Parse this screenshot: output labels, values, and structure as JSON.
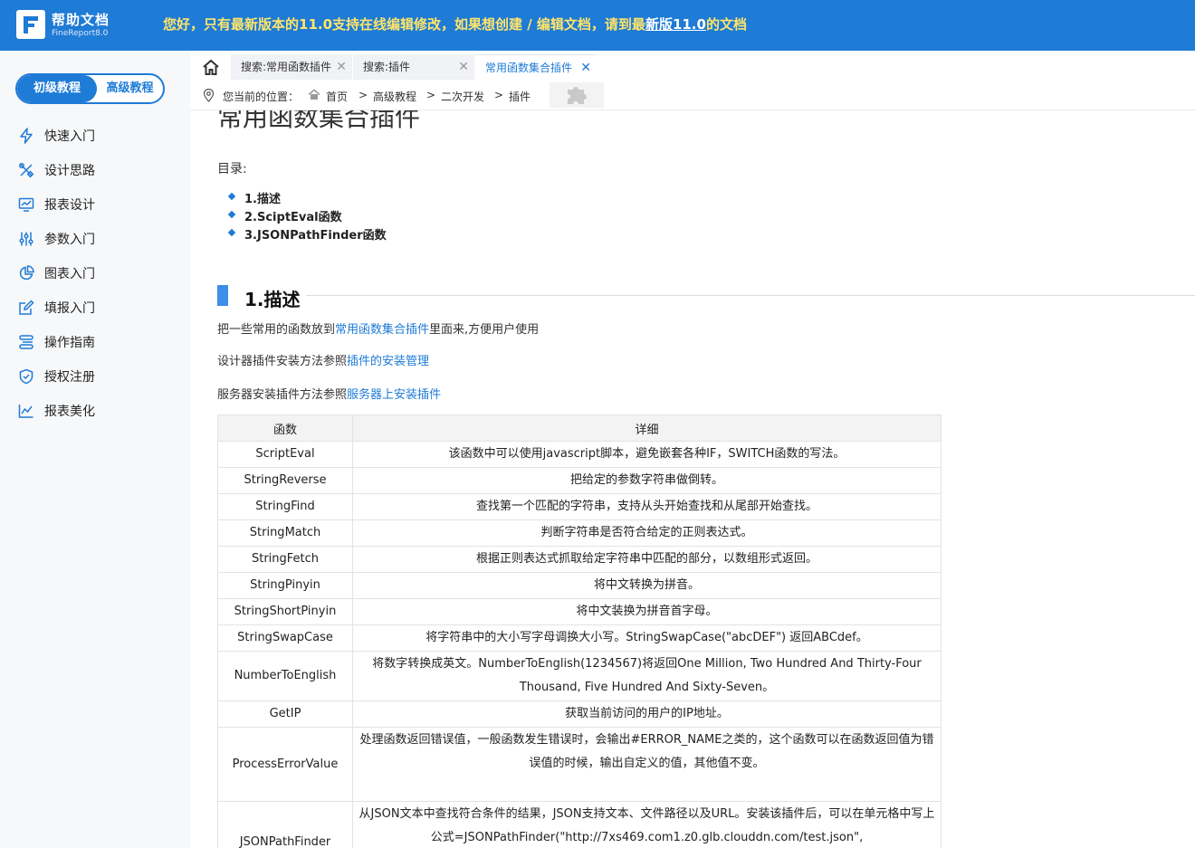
{
  "header": {
    "logo_title": "帮助文档",
    "logo_subtitle": "FineReport8.0",
    "banner_prefix": "您好，只有最新版本的11.0支持在线编辑修改，如果想创建 / 编辑文档，请到最",
    "banner_link": "新版11.0",
    "banner_suffix": "的文档"
  },
  "sidebar": {
    "toggle_left": "初级教程",
    "toggle_right": "高级教程",
    "items": [
      {
        "label": "快速入门",
        "icon": "lightning-icon"
      },
      {
        "label": "设计思路",
        "icon": "tools-icon"
      },
      {
        "label": "报表设计",
        "icon": "monitor-chart-icon"
      },
      {
        "label": "参数入门",
        "icon": "sliders-icon"
      },
      {
        "label": "图表入门",
        "icon": "pie-chart-icon"
      },
      {
        "label": "填报入门",
        "icon": "edit-icon"
      },
      {
        "label": "操作指南",
        "icon": "guide-icon"
      },
      {
        "label": "授权注册",
        "icon": "shield-icon"
      },
      {
        "label": "报表美化",
        "icon": "line-chart-icon"
      }
    ]
  },
  "tabs": [
    {
      "label": "搜索:常用函数插件",
      "active": false
    },
    {
      "label": "搜索:插件",
      "active": false
    },
    {
      "label": "常用函数集合插件",
      "active": true
    }
  ],
  "breadcrumb": {
    "prefix": "您当前的位置：",
    "items": [
      "首页",
      "高级教程",
      "二次开发",
      "插件"
    ],
    "separator": ">"
  },
  "doc": {
    "title": "常用函数集合插件",
    "toc_label": "目录:",
    "toc": [
      "1.描述",
      "2.SciptEval函数",
      "3.JSONPathFinder函数"
    ],
    "section_title": "1.描述",
    "p1_prefix": "把一些常用的函数放到",
    "p1_link": "常用函数集合插件",
    "p1_suffix": "里面来,方便用户使用",
    "p2_prefix": "设计器插件安装方法参照",
    "p2_link": "插件的安装管理",
    "p3_prefix": "服务器安装插件方法参照",
    "p3_link": "服务器上安装插件",
    "table": {
      "headers": [
        "函数",
        "详细"
      ],
      "rows": [
        {
          "name": "ScriptEval",
          "detail": "该函数中可以使用javascript脚本，避免嵌套各种IF，SWITCH函数的写法。"
        },
        {
          "name": "StringReverse",
          "detail": "把给定的参数字符串做倒转。"
        },
        {
          "name": "StringFind",
          "detail": "查找第一个匹配的字符串，支持从头开始查找和从尾部开始查找。"
        },
        {
          "name": "StringMatch",
          "detail": "判断字符串是否符合给定的正则表达式。"
        },
        {
          "name": "StringFetch",
          "detail": "根据正则表达式抓取给定字符串中匹配的部分，以数组形式返回。"
        },
        {
          "name": "StringPinyin",
          "detail": "将中文转换为拼音。"
        },
        {
          "name": "StringShortPinyin",
          "detail": "将中文装换为拼音首字母。"
        },
        {
          "name": "StringSwapCase",
          "detail": "将字符串中的大小写字母调换大小写。StringSwapCase(\"abcDEF\") 返回ABCdef。"
        },
        {
          "name": "NumberToEnglish",
          "detail": "将数字转换成英文。NumberToEnglish(1234567)将返回One Million, Two Hundred And Thirty-Four Thousand, Five Hundred And Sixty-Seven。"
        },
        {
          "name": "GetIP",
          "detail": "获取当前访问的用户的IP地址。"
        },
        {
          "name": "ProcessErrorValue",
          "detail": "处理函数返回错误值，一般函数发生错误时，会输出#ERROR_NAME之类的，这个函数可以在函数返回值为错误值的时候，输出自定义的值，其他值不变。"
        },
        {
          "name": "JSONPathFinder",
          "detail": "从JSON文本中查找符合条件的结果，JSON支持文本、文件路径以及URL。安装该插件后，可以在单元格中写上公式=JSONPathFinder(\"http://7xs469.com1.z0.glb.clouddn.com/test.json\", \"$.store.book[*].author\")查看结"
        }
      ]
    }
  }
}
